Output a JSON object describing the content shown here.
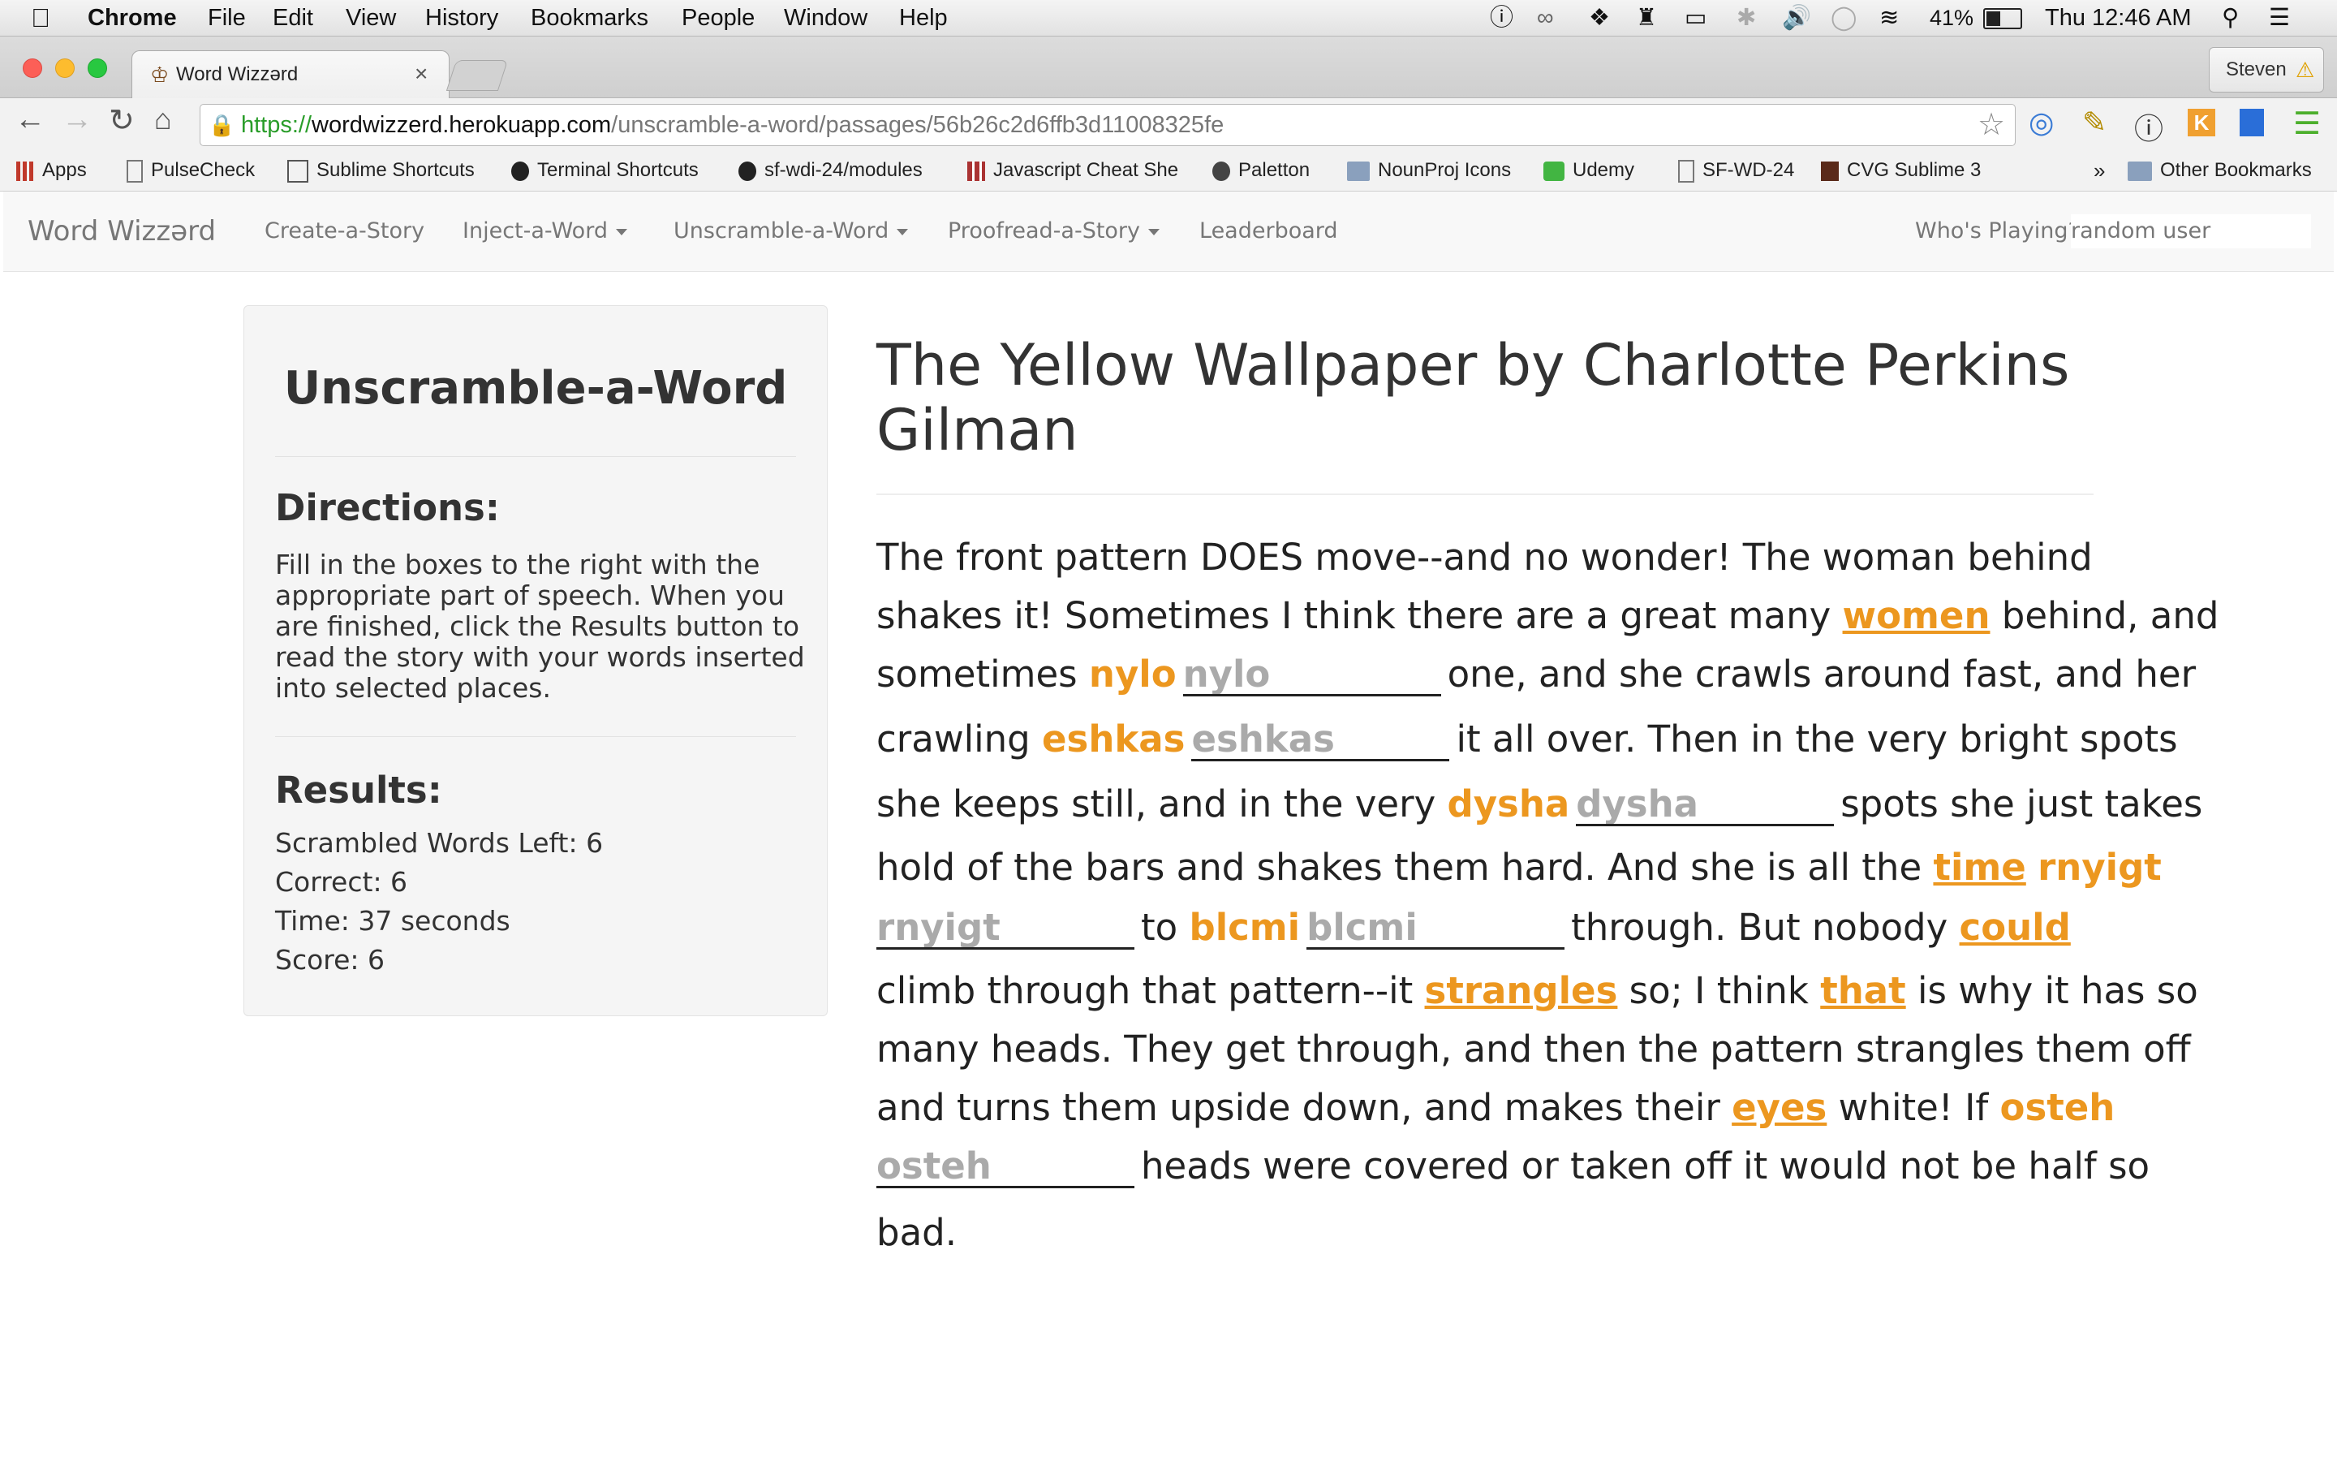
{
  "menubar": {
    "apple": "",
    "app": "Chrome",
    "items": [
      "File",
      "Edit",
      "View",
      "History",
      "Bookmarks",
      "People",
      "Window",
      "Help"
    ],
    "battery": "41%",
    "clock": "Thu 12:46 AM"
  },
  "browser": {
    "tab_title": "Word Wizzərd",
    "profile": "Steven",
    "url_scheme": "https://",
    "url_host": "wordwizzerd.herokuapp.com",
    "url_path": "/unscramble-a-word/passages/56b26c2d6ffb3d11008325fe",
    "bookmarks": [
      "Apps",
      "PulseCheck",
      "Sublime Shortcuts",
      "Terminal Shortcuts",
      "sf-wdi-24/modules",
      "Javascript Cheat She",
      "Paletton",
      "NounProj Icons",
      "Udemy",
      "SF-WD-24",
      "CVG Sublime 3"
    ],
    "bookmarks_overflow": "»",
    "other_bookmarks": "Other Bookmarks"
  },
  "nav": {
    "brand": "Word Wizzərd",
    "links": [
      "Create-a-Story",
      "Inject-a-Word",
      "Unscramble-a-Word",
      "Proofread-a-Story",
      "Leaderboard"
    ],
    "player_label": "Who's Playing?",
    "player_name": "random user"
  },
  "sidebar": {
    "title": "Unscramble-a-Word",
    "directions_heading": "Directions:",
    "directions_lines": [
      "Fill in the boxes to the right with the",
      "appropriate part of speech. When you",
      "are finished, click the Results button to",
      "read the story with your words inserted",
      "into selected places."
    ],
    "results_heading": "Results:",
    "results": [
      "Scrambled Words Left: 6",
      "Correct: 6",
      "Time: 37 seconds",
      "Score: 6"
    ]
  },
  "story": {
    "title_line1": "The Yellow Wallpaper by Charlotte Perkins",
    "title_line2": "Gilman",
    "l1": "The front pattern DOES move--and no wonder! The woman behind",
    "l2a": "shakes it! Sometimes I think there are a great many ",
    "l2w": "women",
    "l2b": " behind, and",
    "l3a": "sometimes ",
    "l3w": "nylo",
    "l3p": "nylo",
    "l3b": "one, and she crawls around fast, and her",
    "l4a": "crawling ",
    "l4w": "eshkas",
    "l4p": "eshkas",
    "l4b": "it all over. Then in the very bright spots",
    "l5a": "she keeps still, and in the very ",
    "l5w": "dysha",
    "l5p": "dysha",
    "l5b": "spots she just takes",
    "l6a": "hold of the bars and shakes them hard. And she is all the ",
    "l6w": "time",
    "l6w2": "rnyigt",
    "l7p": "rnyigt",
    "l7a": "to ",
    "l7w": "blcmi",
    "l7p2": "blcmi",
    "l7b": "through. But nobody ",
    "l7w2": "could",
    "l8a": "climb through that pattern--it ",
    "l8w": "strangles",
    "l8b": " so; I think ",
    "l8w2": "that",
    "l8c": " is why it has so",
    "l9": "many heads. They get through, and then the pattern strangles them off",
    "l10a": "and turns them upside down, and makes their ",
    "l10w": "eyes",
    "l10b": " white! If ",
    "l10w2": "osteh",
    "l11p": "osteh",
    "l11b": "heads were covered or taken off it would not be half so",
    "l12": "bad."
  }
}
